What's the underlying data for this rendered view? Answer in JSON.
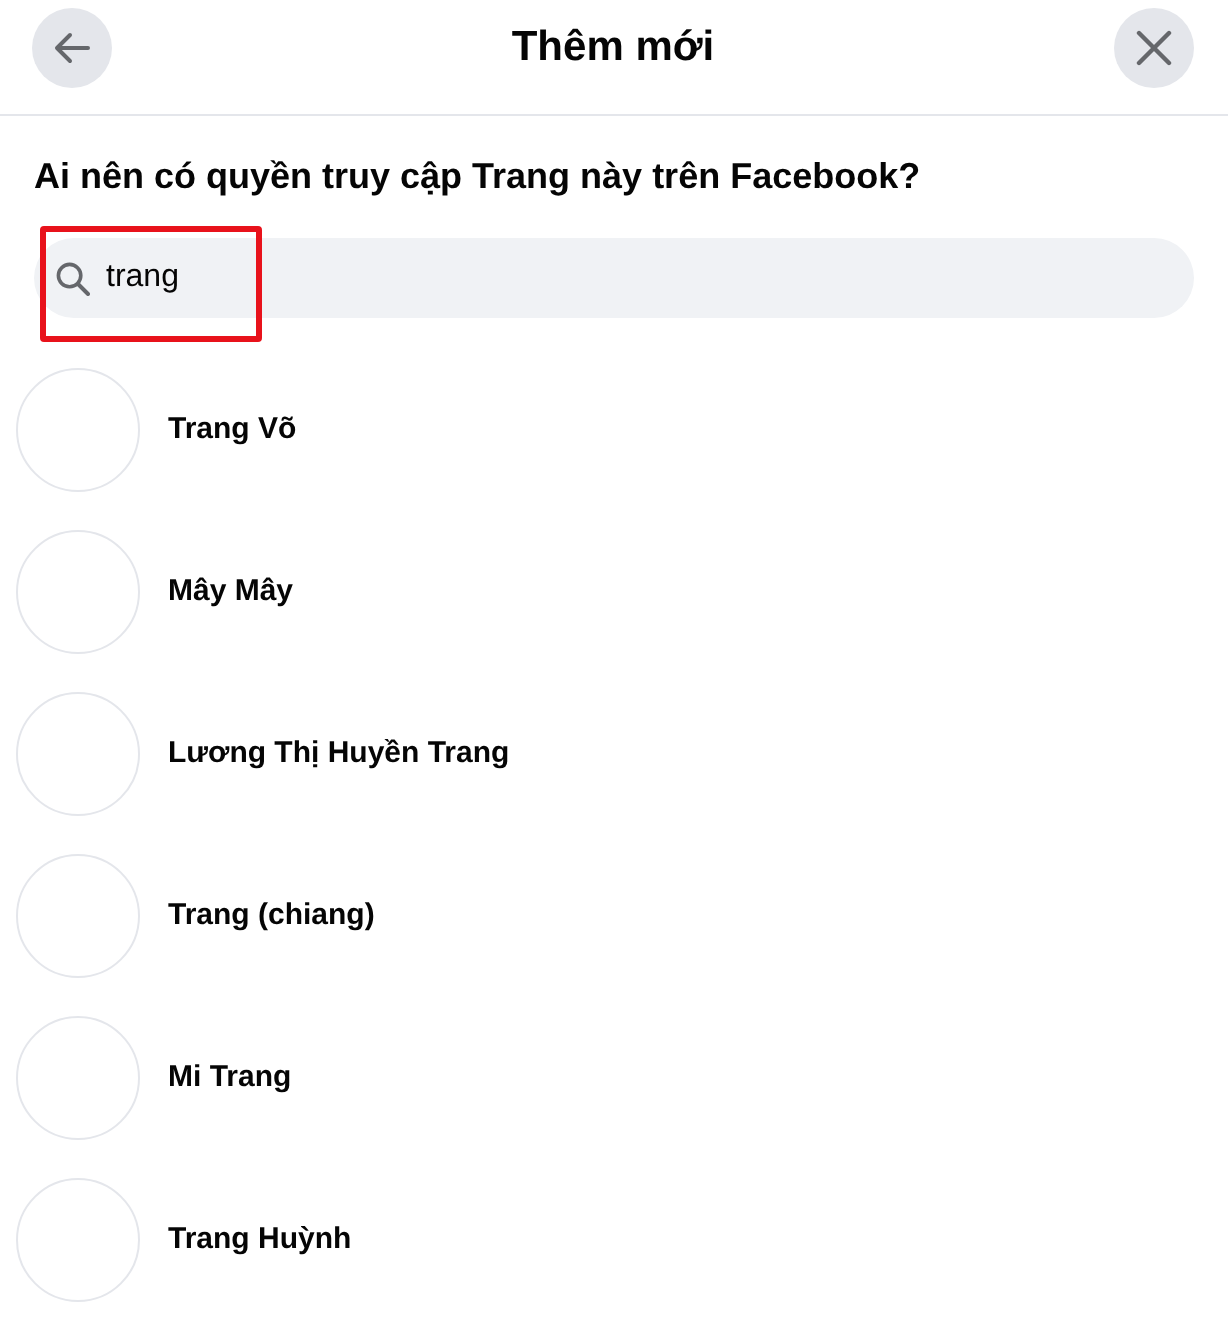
{
  "header": {
    "title": "Thêm mới"
  },
  "prompt": "Ai nên có quyền truy cập Trang này trên Facebook?",
  "search": {
    "value": "trang",
    "highlighted": true
  },
  "results": [
    {
      "name": "Trang Võ"
    },
    {
      "name": "Mây Mây"
    },
    {
      "name": "Lương Thị Huyền Trang"
    },
    {
      "name": "Trang (chiang)"
    },
    {
      "name": "Mi Trang"
    },
    {
      "name": "Trang Huỳnh"
    }
  ]
}
